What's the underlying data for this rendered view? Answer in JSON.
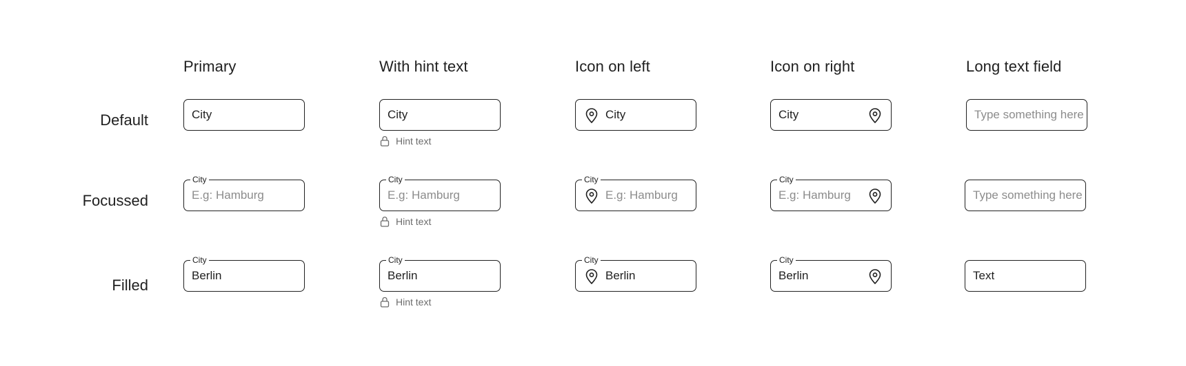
{
  "columns": {
    "primary": "Primary",
    "hint": "With hint text",
    "icon_left": "Icon on left",
    "icon_right": "Icon on right",
    "long": "Long text field"
  },
  "rows": {
    "default": "Default",
    "focussed": "Focussed",
    "filled": "Filled"
  },
  "field_label": "City",
  "focus_placeholder": "E.g: Hamburg",
  "filled_value": "Berlin",
  "hint_text": "Hint text",
  "long_placeholder": "Type something here",
  "long_filled_value": "Text",
  "icons": {
    "location": "location-pin-icon",
    "lock": "lock-icon"
  }
}
